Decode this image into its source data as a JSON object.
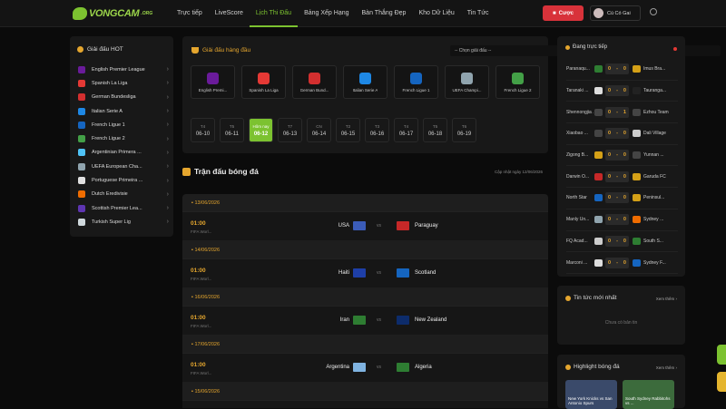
{
  "brand": {
    "logo_text": "VONGCAM",
    "logo_domain": ".ORG"
  },
  "nav": [
    "Trực tiếp",
    "LiveScore",
    "Lịch Thi Đấu",
    "Bảng Xếp Hạng",
    "Bàn Thắng Đẹp",
    "Kho Dữ Liệu",
    "Tin Tức"
  ],
  "nav_active": "Lịch Thi Đấu",
  "header": {
    "bet_label": "Cược",
    "user_name": "Cú Có Gai"
  },
  "hot_leagues": {
    "title": "Giải đấu HOT",
    "items": [
      {
        "label": "English Premier League",
        "color": "#6a1b9a"
      },
      {
        "label": "Spanish La Liga",
        "color": "#e53935"
      },
      {
        "label": "German Bundesliga",
        "color": "#d32f2f"
      },
      {
        "label": "Italian Serie A",
        "color": "#1e88e5"
      },
      {
        "label": "French Ligue 1",
        "color": "#1565c0"
      },
      {
        "label": "French Ligue 2",
        "color": "#43a047"
      },
      {
        "label": "Argentinian Primera ...",
        "color": "#4fc3f7"
      },
      {
        "label": "UEFA European Cha...",
        "color": "#90a4ae"
      },
      {
        "label": "Portuguese Primeira ...",
        "color": "#e0e0e0"
      },
      {
        "label": "Dutch Eredivisie",
        "color": "#ef6c00"
      },
      {
        "label": "Scottish Premier Lea...",
        "color": "#5e35b1"
      },
      {
        "label": "Turkish Super Lig",
        "color": "#cfd8dc"
      }
    ]
  },
  "league_select": {
    "label": "Giải đấu hàng đầu",
    "placeholder": "-- Chọn giải đấu --",
    "cards": [
      {
        "label": "English Premi...",
        "color": "#6a1b9a"
      },
      {
        "label": "Spanish La Liga",
        "color": "#e53935"
      },
      {
        "label": "German Bund...",
        "color": "#d32f2f"
      },
      {
        "label": "Italian Serie A",
        "color": "#1e88e5"
      },
      {
        "label": "French Ligue 1",
        "color": "#1565c0"
      },
      {
        "label": "UEFA Champi...",
        "color": "#90a4ae"
      },
      {
        "label": "French Ligue 2",
        "color": "#43a047"
      }
    ]
  },
  "dates": [
    {
      "dow": "T4",
      "day": "06-10"
    },
    {
      "dow": "T5",
      "day": "06-11"
    },
    {
      "dow": "Hôm nay",
      "day": "06-12",
      "active": true
    },
    {
      "dow": "T7",
      "day": "06-13"
    },
    {
      "dow": "CN",
      "day": "06-14"
    },
    {
      "dow": "T2",
      "day": "06-15"
    },
    {
      "dow": "T3",
      "day": "06-16"
    },
    {
      "dow": "T4",
      "day": "06-17"
    },
    {
      "dow": "T5",
      "day": "06-18"
    },
    {
      "dow": "T6",
      "day": "06-19"
    }
  ],
  "matches": {
    "title": "Trận đấu bóng đá",
    "updated": "Cập nhật ngày 12/06/2026",
    "groups": [
      {
        "date": "13/06/2026",
        "time": "01:00",
        "comp": "FIFA Worl...",
        "home": "USA",
        "away": "Paraguay",
        "home_flag": "#3b5cb8",
        "away_flag": "#c62828"
      },
      {
        "date": "14/06/2026",
        "time": "01:00",
        "comp": "FIFA Worl...",
        "home": "Haiti",
        "away": "Scotland",
        "home_flag": "#1e3fa8",
        "away_flag": "#1565c0"
      },
      {
        "date": "16/06/2026",
        "time": "01:00",
        "comp": "FIFA Worl...",
        "home": "Iran",
        "away": "New Zealand",
        "home_flag": "#2e7d32",
        "away_flag": "#0d2c6b"
      },
      {
        "date": "17/06/2026",
        "time": "01:00",
        "comp": "FIFA Worl...",
        "home": "Argentina",
        "away": "Algeria",
        "home_flag": "#7fb3e0",
        "away_flag": "#2e7d32"
      },
      {
        "date": "15/06/2026"
      }
    ]
  },
  "live": {
    "title": "Đang trực tiếp",
    "rows": [
      {
        "home": "Paranaqu...",
        "hs": "0",
        "as": "0",
        "away": "Imus Bra...",
        "hc": "#2e7d32",
        "ac": "#d4a017"
      },
      {
        "home": "Taranaki ...",
        "hs": "0",
        "as": "0",
        "away": "Tauranga...",
        "hc": "#ddd",
        "ac": "#222"
      },
      {
        "home": "Shennongjia ...",
        "hs": "0",
        "as": "1",
        "away": "Ezhou Team",
        "hc": "#444",
        "ac": "#444"
      },
      {
        "home": "Xiaobao ...",
        "hs": "0",
        "as": "0",
        "away": "Dali Village",
        "hc": "#444",
        "ac": "#ccc"
      },
      {
        "home": "Zigong B...",
        "hs": "0",
        "as": "0",
        "away": "Yunnan ...",
        "hc": "#d4a017",
        "ac": "#444"
      },
      {
        "home": "Darwin O...",
        "hs": "0",
        "as": "0",
        "away": "Garuda FC",
        "hc": "#c62828",
        "ac": "#d4a017"
      },
      {
        "home": "North Star",
        "hs": "0",
        "as": "0",
        "away": "Peninsul...",
        "hc": "#1565c0",
        "ac": "#d4a017"
      },
      {
        "home": "Manly Un...",
        "hs": "0",
        "as": "0",
        "away": "Sydney ...",
        "hc": "#90a4ae",
        "ac": "#ef6c00"
      },
      {
        "home": "FQ Acad...",
        "hs": "0",
        "as": "0",
        "away": "South S...",
        "hc": "#ccc",
        "ac": "#2e7d32"
      },
      {
        "home": "Marconi ...",
        "hs": "0",
        "as": "0",
        "away": "Sydney F...",
        "hc": "#ddd",
        "ac": "#1565c0"
      }
    ]
  },
  "news": {
    "title": "Tin tức mới nhất",
    "see_more": "Xem thêm",
    "empty": "Chưa có bản tin"
  },
  "highlights": {
    "title": "Highlight bóng đá",
    "see_more": "Xem thêm",
    "items": [
      {
        "label": "New York Knicks vs San Antonio Spurs",
        "color": "#3a4a6a"
      },
      {
        "label": "South Sydney Rabbitohs vs ...",
        "color": "#3c6b3c"
      }
    ]
  }
}
